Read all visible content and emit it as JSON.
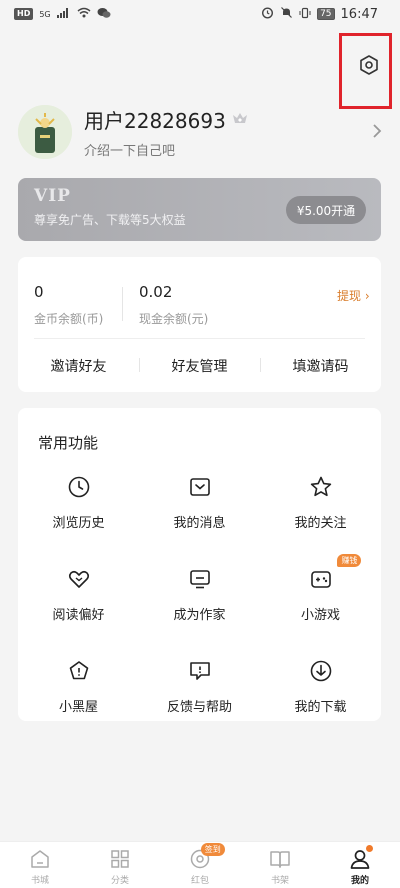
{
  "status_bar": {
    "network_badge": "HD",
    "signal_label": "5G",
    "battery": "75",
    "time": "16:47"
  },
  "profile": {
    "username": "用户22828693",
    "bio": "介绍一下自己吧"
  },
  "vip": {
    "title": "VIP",
    "subtitle": "尊享免广告、下载等5大权益",
    "button_label": "¥5.00开通"
  },
  "wallet": {
    "coin_value": "0",
    "coin_label": "金币余额(币)",
    "cash_value": "0.02",
    "cash_label": "现金余额(元)",
    "withdraw_label": "提现 ›",
    "actions": [
      "邀请好友",
      "好友管理",
      "填邀请码"
    ]
  },
  "functions": {
    "title": "常用功能",
    "items": [
      {
        "label": "浏览历史",
        "icon": "clock-icon"
      },
      {
        "label": "我的消息",
        "icon": "message-box-icon"
      },
      {
        "label": "我的关注",
        "icon": "star-icon"
      },
      {
        "label": "阅读偏好",
        "icon": "heart-icon"
      },
      {
        "label": "成为作家",
        "icon": "monitor-icon"
      },
      {
        "label": "小游戏",
        "icon": "gamepad-icon",
        "badge": "赚钱"
      },
      {
        "label": "小黑屋",
        "icon": "pentagon-alert-icon"
      },
      {
        "label": "反馈与帮助",
        "icon": "feedback-icon"
      },
      {
        "label": "我的下载",
        "icon": "download-icon"
      }
    ]
  },
  "tabs": [
    {
      "label": "书城",
      "icon": "home-icon"
    },
    {
      "label": "分类",
      "icon": "grid-icon"
    },
    {
      "label": "红包",
      "icon": "red-packet-icon",
      "badge": "签到"
    },
    {
      "label": "书架",
      "icon": "book-icon"
    },
    {
      "label": "我的",
      "icon": "user-icon",
      "active": true
    }
  ],
  "colors": {
    "accent": "#f08a3a",
    "highlight_box": "#e0232b",
    "vip_bg": "#b0b0b5",
    "page_bg": "#f4f4f4"
  }
}
